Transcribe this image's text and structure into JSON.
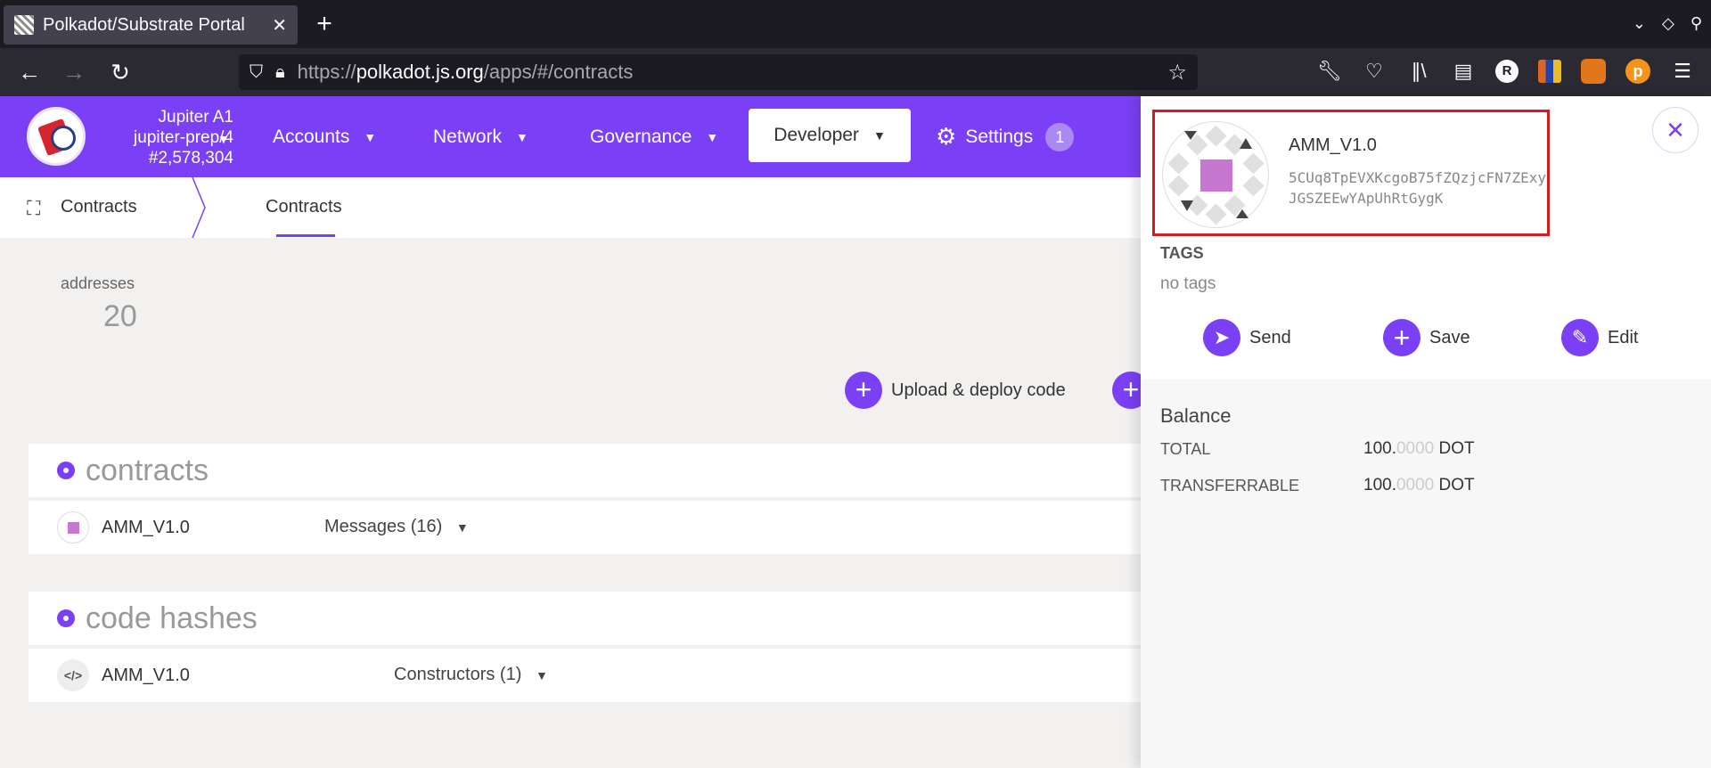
{
  "browser": {
    "tab_title": "Polkadot/Substrate Portal",
    "tab_close": "✕",
    "new_tab": "+",
    "url_prefix": "https://",
    "url_host": "polkadot.js.org",
    "url_path": "/apps/#/contracts",
    "toolbar_avatar_letter": "R",
    "toolbar_extension_letter": "p"
  },
  "app": {
    "chain_name": "Jupiter A1",
    "chain_spec": "jupiter-prep/4",
    "block_number": "#2,578,304",
    "menu": {
      "accounts": "Accounts",
      "network": "Network",
      "governance": "Governance",
      "developer": "Developer",
      "settings": "Settings",
      "settings_badge": "1"
    },
    "subnav": {
      "section": "Contracts",
      "tab": "Contracts"
    },
    "summary": {
      "label": "addresses",
      "value": "20"
    },
    "actions": {
      "upload_deploy": "Upload & deploy code"
    },
    "contracts_section": {
      "title": "contracts",
      "rows": [
        {
          "name": "AMM_V1.0",
          "dropdown": "Messages (16)"
        }
      ]
    },
    "code_hashes_section": {
      "title": "code hashes",
      "rows": [
        {
          "name": "AMM_V1.0",
          "dropdown": "Constructors (1)",
          "icon": "</>"
        }
      ]
    }
  },
  "sidebar": {
    "account_name": "AMM_V1.0",
    "address": "5CUq8TpEVXKcgoB75fZQzjcFN7ZExyJGSZEEwYApUhRtGygK",
    "tags_label": "TAGS",
    "tags_value": "no tags",
    "actions": {
      "send": "Send",
      "save": "Save",
      "edit": "Edit"
    },
    "balance": {
      "title": "Balance",
      "rows": [
        {
          "label": "TOTAL",
          "int": "100.",
          "dec": "0000",
          "unit": "DOT"
        },
        {
          "label": "TRANSFERRABLE",
          "int": "100.",
          "dec": "0000",
          "unit": "DOT"
        }
      ]
    },
    "close": "✕"
  },
  "colors": {
    "accent": "#7b3ff5",
    "highlight": "#d71920",
    "identicon_center": "#c678d0"
  },
  "icons": [
    "page-grid-icon",
    "back-arrow-icon",
    "forward-arrow-icon",
    "reload-icon",
    "shield-icon",
    "lock-icon",
    "bookmark-star-icon",
    "wrench-icon",
    "pocket-icon",
    "library-icon",
    "sidebar-icon",
    "gear-icon",
    "contracts-icon",
    "send-icon",
    "plus-icon",
    "edit-icon",
    "close-icon",
    "caret-down-icon",
    "code-icon"
  ]
}
